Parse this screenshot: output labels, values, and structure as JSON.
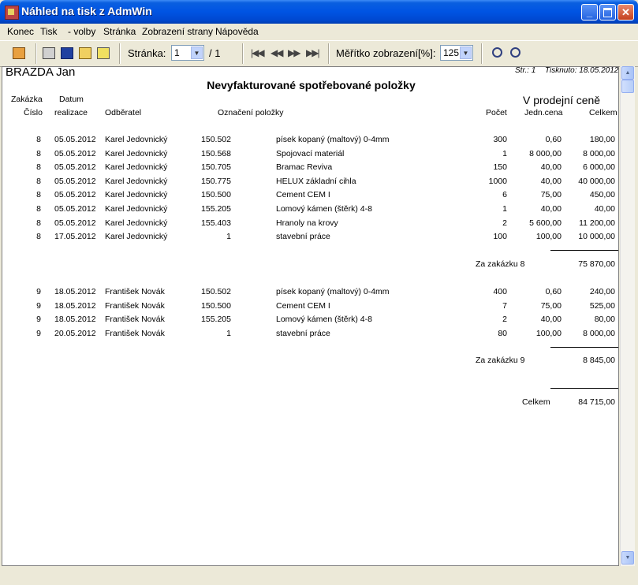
{
  "window": {
    "title": "Náhled na tisk z AdmWin"
  },
  "menu": [
    "Konec",
    "Tisk",
    "- volby",
    "Stránka",
    "Zobrazení strany",
    "Nápověda"
  ],
  "toolbar": {
    "page_label": "Stránka:",
    "page_value": "1",
    "page_total": "/ 1",
    "scale_label": "Měřítko zobrazení[%]:",
    "scale_value": "125"
  },
  "report": {
    "company": "BRÁZDA Jan",
    "page_info": "Str.: 1",
    "printed": "Tisknuto: 18.05.2012",
    "title": "Nevyfakturované spotřebované položky",
    "price_mode": "V prodejní ceně",
    "headers": {
      "zakazka": "Zakázka",
      "cislo": "Číslo",
      "datum": "Datum",
      "realizace": "realizace",
      "odberatel": "Odběratel",
      "oznaceni": "Označení položky",
      "pocet": "Počet",
      "jedn_cena": "Jedn.cena",
      "celkem": "Celkem"
    },
    "groups": [
      {
        "rows": [
          [
            "8",
            "05.05.2012",
            "Karel Jedovnický",
            "150.502",
            "písek kopaný (maltový) 0-4mm",
            "300",
            "0,60",
            "180,00"
          ],
          [
            "8",
            "05.05.2012",
            "Karel Jedovnický",
            "150.568",
            "Spojovací materiál",
            "1",
            "8 000,00",
            "8 000,00"
          ],
          [
            "8",
            "05.05.2012",
            "Karel Jedovnický",
            "150.705",
            "Bramac Reviva",
            "150",
            "40,00",
            "6 000,00"
          ],
          [
            "8",
            "05.05.2012",
            "Karel Jedovnický",
            "150.775",
            "HELUX základní cihla",
            "1000",
            "40,00",
            "40 000,00"
          ],
          [
            "8",
            "05.05.2012",
            "Karel Jedovnický",
            "150.500",
            "Cement CEM I",
            "6",
            "75,00",
            "450,00"
          ],
          [
            "8",
            "05.05.2012",
            "Karel Jedovnický",
            "155.205",
            "Lomový kámen (štěrk) 4-8",
            "1",
            "40,00",
            "40,00"
          ],
          [
            "8",
            "05.05.2012",
            "Karel Jedovnický",
            "155.403",
            "Hranoly na krovy",
            "2",
            "5 600,00",
            "11 200,00"
          ],
          [
            "8",
            "17.05.2012",
            "Karel Jedovnický",
            "1",
            "stavební práce",
            "100",
            "100,00",
            "10 000,00"
          ]
        ],
        "subtotal_label": "Za zakázku",
        "subtotal_order": "8",
        "subtotal_value": "75 870,00"
      },
      {
        "rows": [
          [
            "9",
            "18.05.2012",
            "František Novák",
            "150.502",
            "písek kopaný (maltový) 0-4mm",
            "400",
            "0,60",
            "240,00"
          ],
          [
            "9",
            "18.05.2012",
            "František Novák",
            "150.500",
            "Cement CEM I",
            "7",
            "75,00",
            "525,00"
          ],
          [
            "9",
            "18.05.2012",
            "František Novák",
            "155.205",
            "Lomový kámen (štěrk) 4-8",
            "2",
            "40,00",
            "80,00"
          ],
          [
            "9",
            "20.05.2012",
            "František Novák",
            "1",
            "stavební práce",
            "80",
            "100,00",
            "8 000,00"
          ]
        ],
        "subtotal_label": "Za zakázku",
        "subtotal_order": "9",
        "subtotal_value": "8 845,00"
      }
    ],
    "grand_total_label": "Celkem",
    "grand_total_value": "84 715,00"
  }
}
